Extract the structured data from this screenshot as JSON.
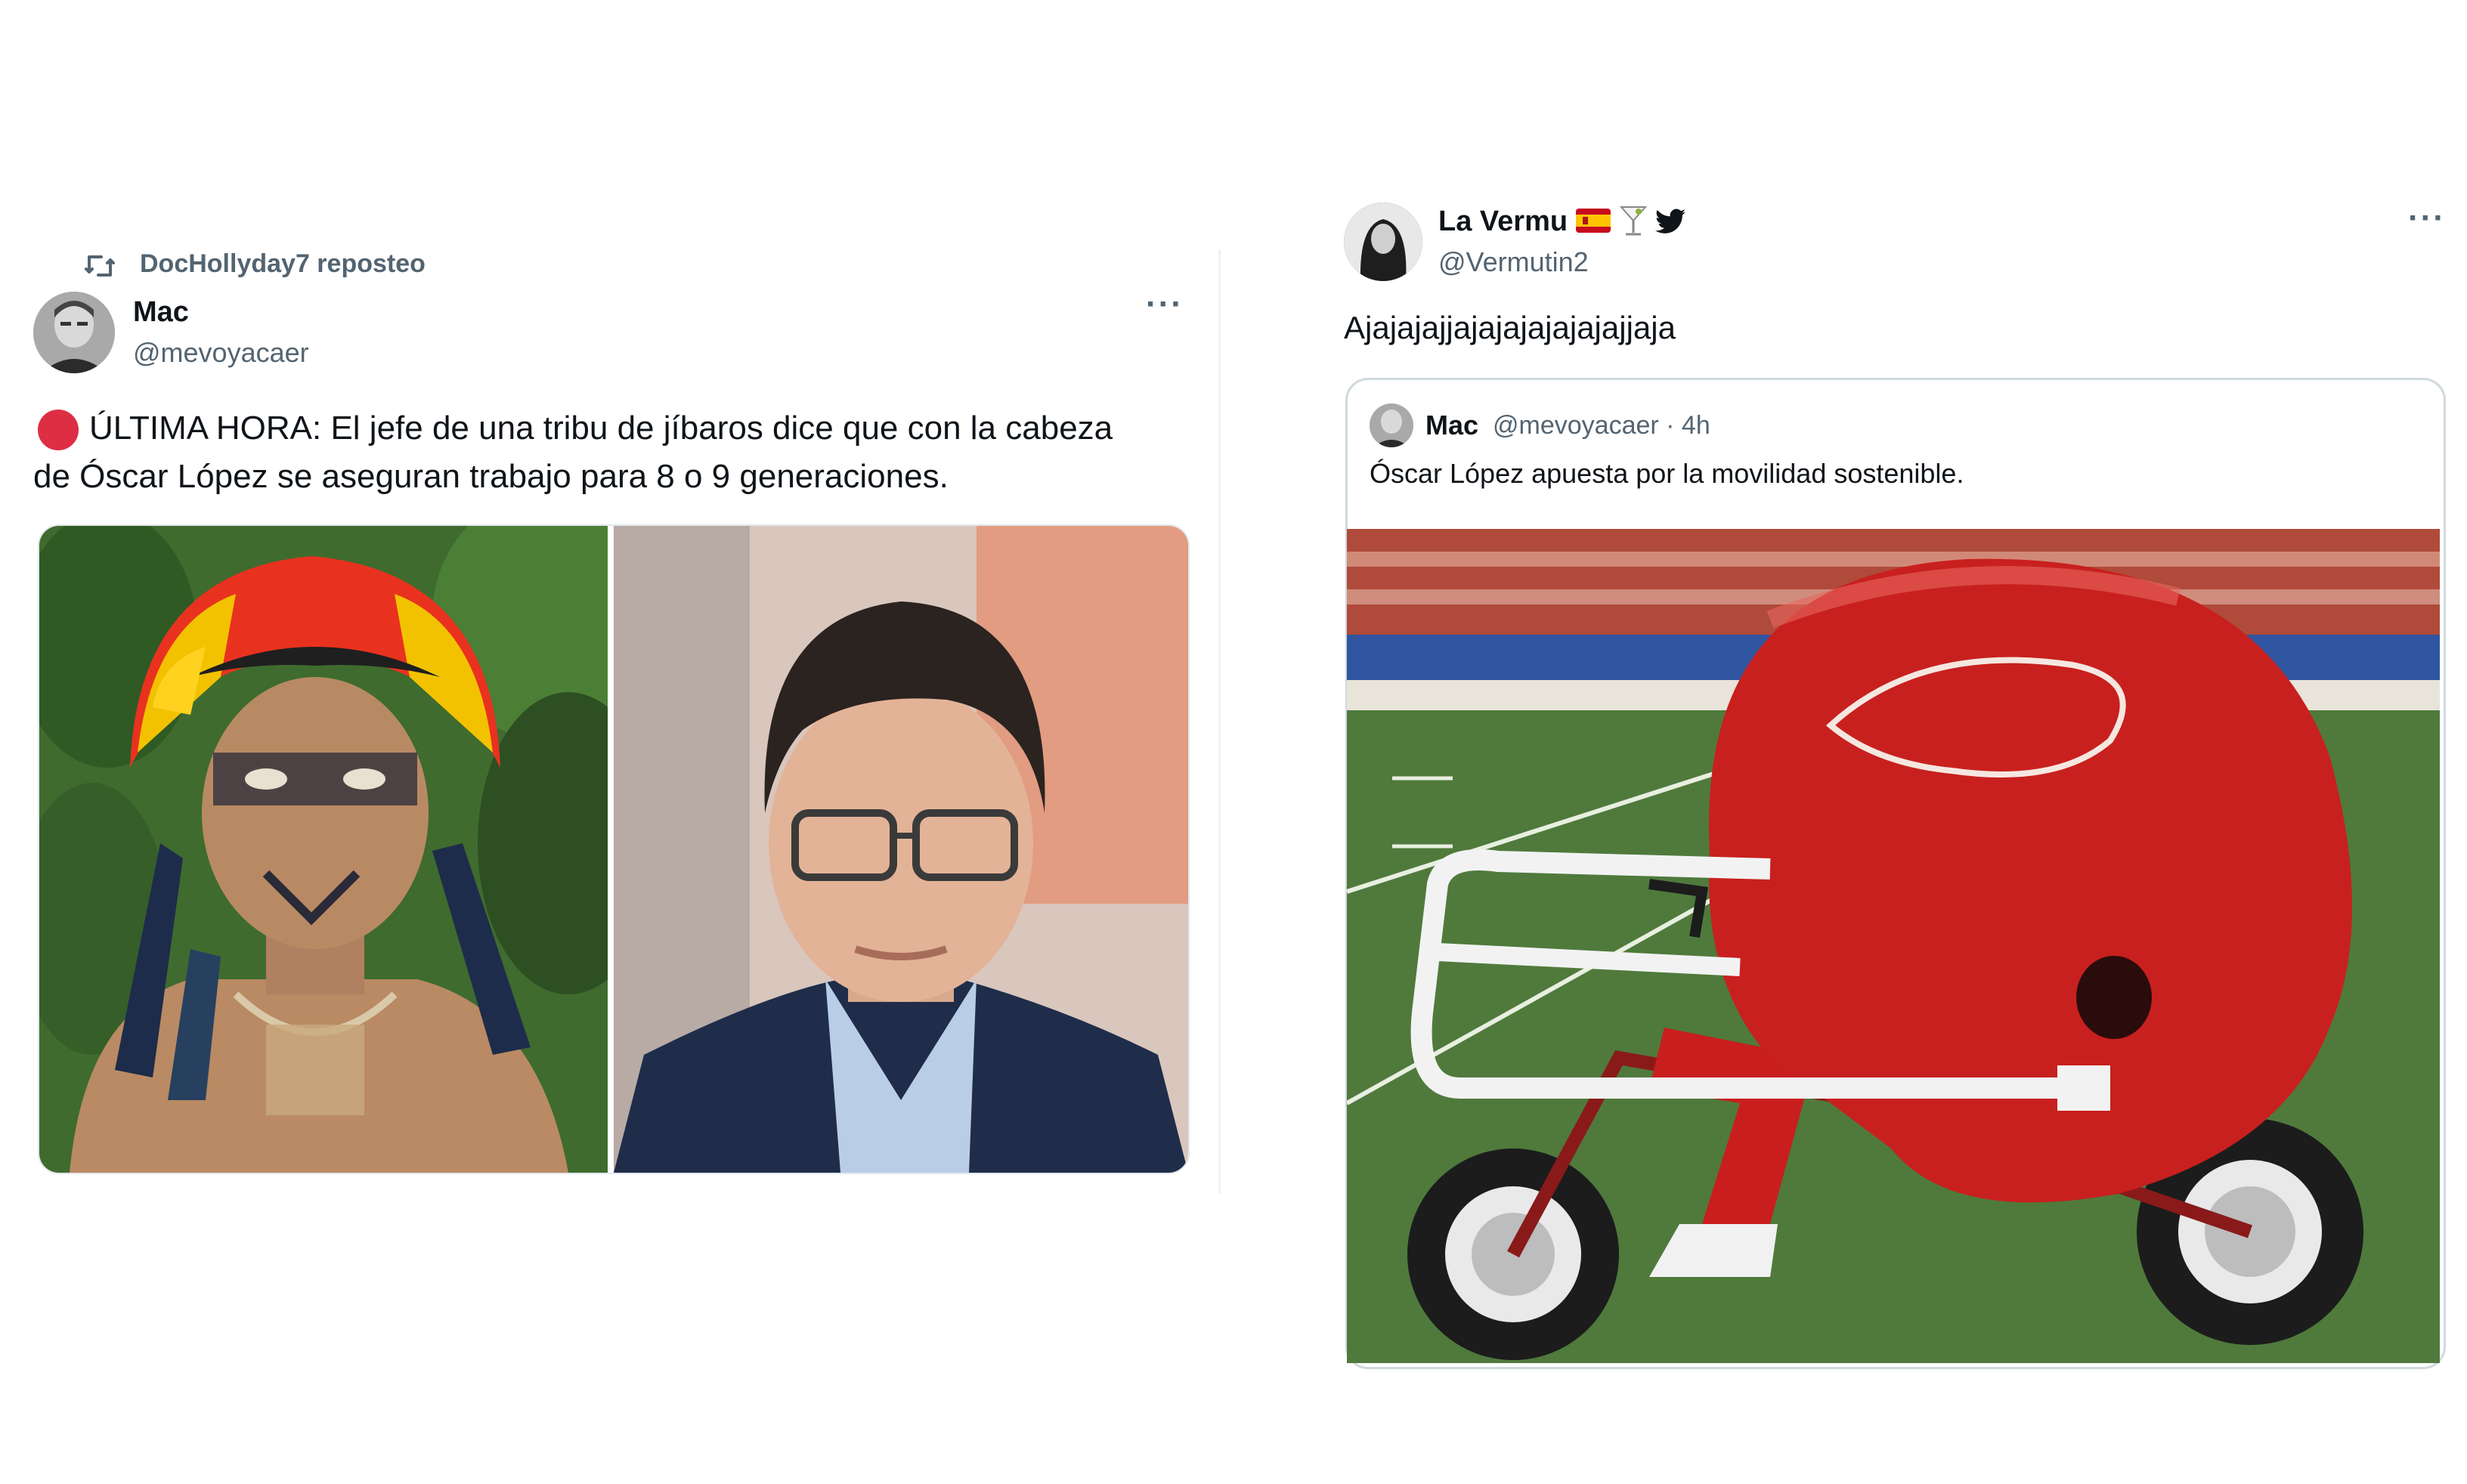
{
  "left_tweet": {
    "repost_label": "DocHollyday7 reposteo",
    "author_name": "Mac",
    "author_handle": "@mevoyacaer",
    "more_label": "···",
    "text_line_1": "ÚLTIMA HORA: El jefe de una tribu de jíbaros dice que con la cabeza",
    "text_line_2": "de Óscar López se aseguran trabajo para 8 o 9 generaciones."
  },
  "right_tweet": {
    "author_name": "La Vermu",
    "author_handle": "@Vermutin2",
    "more_label": "···",
    "text": "Ajajajajjajajajajajajajjaja",
    "quoted": {
      "author_name": "Mac",
      "meta": "@mevoyacaer · 4h",
      "text": "Óscar López apuesta por la movilidad sostenible."
    }
  },
  "icons": [
    "repost-icon",
    "more-icon",
    "red-circle-icon",
    "spain-flag-icon",
    "cocktail-icon",
    "twitter-bird-icon"
  ],
  "colors": {
    "accent_red": "#dd2e44",
    "secondary_text": "#536471",
    "border": "#cfd9de",
    "helmet_red": "#c8201f",
    "field_green": "#4f7a3c"
  }
}
